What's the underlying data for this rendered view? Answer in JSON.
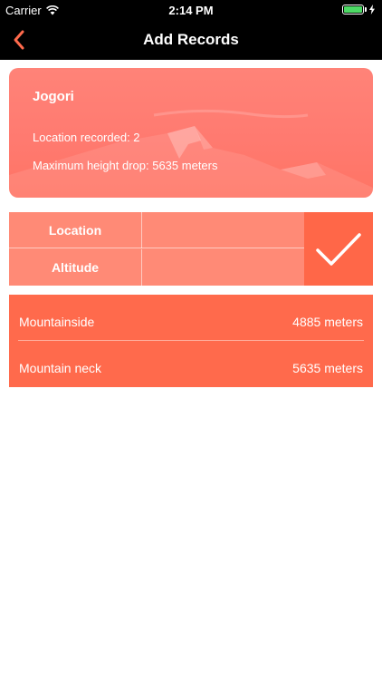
{
  "status_bar": {
    "carrier": "Carrier",
    "time": "2:14 PM"
  },
  "nav": {
    "title": "Add Records",
    "back_icon": "chevron-left-icon"
  },
  "summary": {
    "name": "Jogori",
    "locations_recorded": "Location recorded: 2",
    "max_height_drop": "Maximum height drop: 5635 meters"
  },
  "form": {
    "location_label": "Location",
    "altitude_label": "Altitude",
    "location_value": "",
    "altitude_value": "",
    "confirm_icon": "checkmark-icon"
  },
  "records": [
    {
      "location": "Mountainside",
      "altitude": "4885 meters"
    },
    {
      "location": "Mountain neck",
      "altitude": "5635 meters"
    }
  ],
  "colors": {
    "accent": "#ff6748",
    "card": "#ff7a70",
    "form": "#ff8a76",
    "records": "#ff6a4c",
    "back": "#ff6a4c"
  }
}
